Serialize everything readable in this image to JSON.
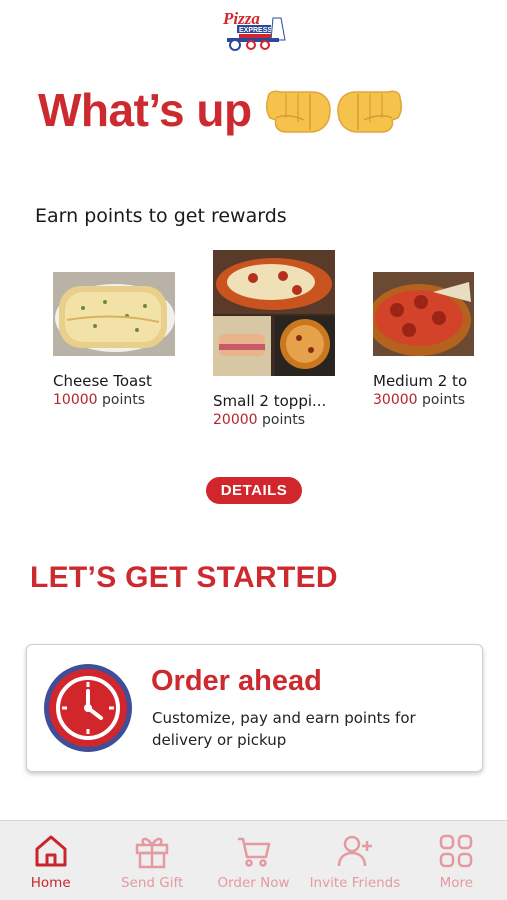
{
  "brand": {
    "logo_icon": "pizza-express-logo-icon",
    "accent": "#cc2a2f",
    "accent_light": "#e39aa0"
  },
  "greeting": {
    "text": "What’s up",
    "emoji": "fist-bump-icon"
  },
  "rewards": {
    "heading": "Earn points to get rewards",
    "items": [
      {
        "name": "Cheese Toast",
        "points": "10000",
        "points_label": " points"
      },
      {
        "name": "Small 2 toppi...",
        "points": "20000",
        "points_label": " points"
      },
      {
        "name": "Medium 2 to",
        "points": "30000",
        "points_label": " points"
      }
    ],
    "details_label": "DETAILS"
  },
  "get_started": {
    "heading": "LET’S GET STARTED",
    "order": {
      "title": "Order ahead",
      "description": "Customize, pay and earn points for delivery or pickup",
      "icon": "clock-icon"
    }
  },
  "tabbar": {
    "tabs": [
      {
        "label": "Home",
        "icon": "home-icon",
        "active": true
      },
      {
        "label": "Send Gift",
        "icon": "gift-icon",
        "active": false
      },
      {
        "label": "Order Now",
        "icon": "cart-icon",
        "active": false
      },
      {
        "label": "Invite Friends",
        "icon": "add-user-icon",
        "active": false
      },
      {
        "label": "More",
        "icon": "grid-icon",
        "active": false
      }
    ]
  }
}
